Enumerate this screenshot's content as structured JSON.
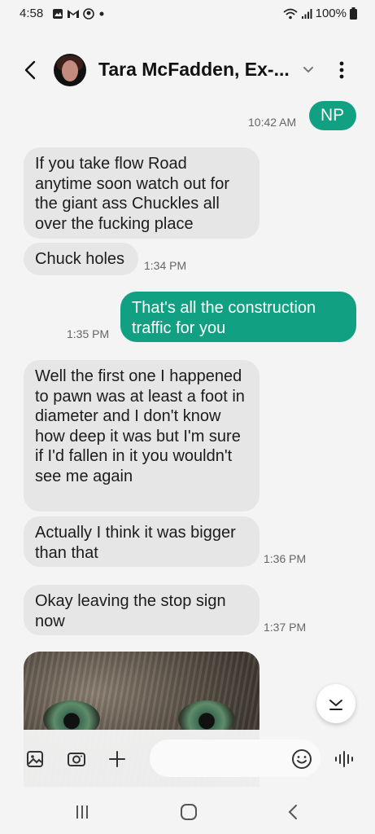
{
  "status": {
    "time": "4:58",
    "battery": "100%",
    "icons": [
      "photo-icon",
      "gmail-icon",
      "messenger-icon",
      "dot-icon",
      "wifi-icon",
      "signal-icon",
      "battery-icon"
    ]
  },
  "header": {
    "contact_name": "Tara McFadden, Ex-...",
    "icons": [
      "back-arrow-icon",
      "avatar",
      "chevron-down-icon",
      "more-vert-icon"
    ]
  },
  "messages": [
    {
      "type": "out",
      "text": "NP",
      "time": "10:42 AM"
    },
    {
      "type": "in",
      "text": "If you take flow Road anytime soon watch out for the giant ass Chuckles all over the fucking place",
      "time": ""
    },
    {
      "type": "in",
      "text": "Chuck holes",
      "time": "1:34 PM"
    },
    {
      "type": "out",
      "text": "That's all the construction traffic for you",
      "time": "1:35 PM"
    },
    {
      "type": "in",
      "text": "Well the first one I happened to pawn was at least a foot in diameter and I don't know how deep it was but I'm sure if I'd fallen in it you wouldn't see me again",
      "time": ""
    },
    {
      "type": "in",
      "text": "Actually I think it was bigger than that",
      "time": "1:36 PM"
    },
    {
      "type": "in",
      "text": "Okay leaving the stop sign now",
      "time": "1:37 PM"
    },
    {
      "type": "in-image",
      "subject": "cat photo"
    }
  ],
  "composer": {
    "icons": [
      "gallery-icon",
      "camera-icon",
      "plus-icon",
      "emoji-icon",
      "voice-record-icon"
    ]
  },
  "colors": {
    "outgoing_bubble": "#12a083",
    "incoming_bubble": "#e6e6e6",
    "background": "#f4f4f4"
  }
}
